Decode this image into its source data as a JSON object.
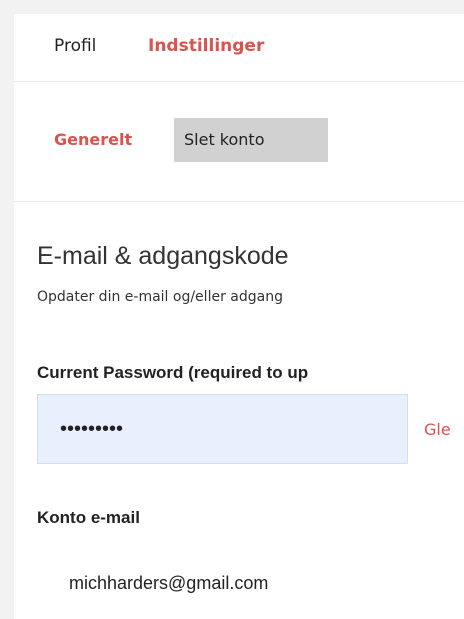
{
  "tabs": {
    "profile": "Profil",
    "settings": "Indstillinger"
  },
  "subtabs": {
    "general": "Generelt",
    "delete_account": "Slet konto"
  },
  "section": {
    "title": "E-mail & adgangskode",
    "description": "Opdater din e-mail og/eller adgang"
  },
  "password": {
    "label": "Current Password (required to up",
    "value": "password1",
    "forgot_link": "Gle"
  },
  "email": {
    "label": "Konto e-mail",
    "value": "michharders@gmail.com"
  },
  "colors": {
    "accent": "#d9534f",
    "password_field_bg": "#e8f0fe",
    "active_subtab_bg": "#d1d1d1"
  }
}
